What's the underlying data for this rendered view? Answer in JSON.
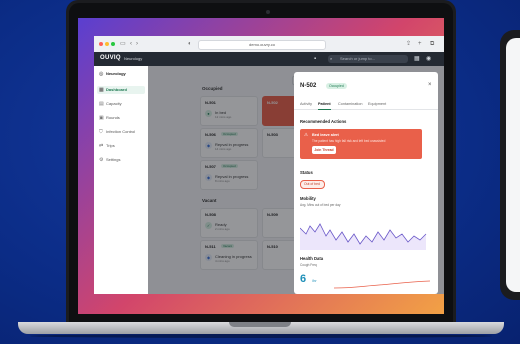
{
  "browser": {
    "url": "demo.ouvry.co"
  },
  "app": {
    "logo": "OUVIQ",
    "unit_selector": "Neurology",
    "search_placeholder": "Search or jump to..."
  },
  "sidebar": {
    "org": "Neurology",
    "items": [
      {
        "label": "Dashboard",
        "icon": "grid-icon",
        "active": true
      },
      {
        "label": "Capacity",
        "icon": "chart-icon"
      },
      {
        "label": "Rounds",
        "icon": "clipboard-icon"
      },
      {
        "label": "Infection Control",
        "icon": "shield-icon"
      },
      {
        "label": "Trips",
        "icon": "route-icon"
      },
      {
        "label": "Settings",
        "icon": "gear-icon"
      }
    ]
  },
  "main": {
    "filter_label": "Filter",
    "occupied_title": "Occupied",
    "vacant_title": "Vacant",
    "occupied_cards": [
      {
        "name": "N-501",
        "badge": "",
        "status": "In bed",
        "time": "12 mins ago"
      },
      {
        "name": "N-506",
        "badge": "Occupied",
        "status": "Repval in progress",
        "time": "14 mins ago"
      },
      {
        "name": "N-507",
        "badge": "Occupied",
        "status": "Repval in progress",
        "time": "8 mins ago"
      }
    ],
    "vacant_cards": [
      {
        "name": "N-508",
        "badge": "",
        "status": "Ready",
        "time": "2 mins ago"
      },
      {
        "name": "N-511",
        "badge": "Vacant",
        "status": "Cleaning in progress",
        "time": "4 mins ago"
      }
    ],
    "right_col_cards": [
      "N-502",
      "N-503",
      "N-509",
      "N-510"
    ]
  },
  "modal": {
    "title": "N-502",
    "badge": "Occupied",
    "tabs": [
      "Activity",
      "Patient",
      "Contamination",
      "Equipment"
    ],
    "active_tab": "Patient",
    "recommended_actions": "Recommended Actions",
    "alert_title": "Bed leave alert",
    "alert_body": "The patient has high fall risk and left bed unassisted",
    "alert_button": "Join Thread",
    "status_heading": "Status",
    "status_value": "Out of bed",
    "mobility_heading": "Mobility",
    "mobility_sub": "Avg. Mins out of bed per day",
    "health_heading": "Health Data",
    "health_sub": "Cough Freq",
    "health_value": "6",
    "health_unit": "/hr"
  },
  "colors": {
    "accent": "#1f7a53",
    "alert": "#e9604a",
    "header": "#242a33",
    "background": "#0b2c86"
  }
}
